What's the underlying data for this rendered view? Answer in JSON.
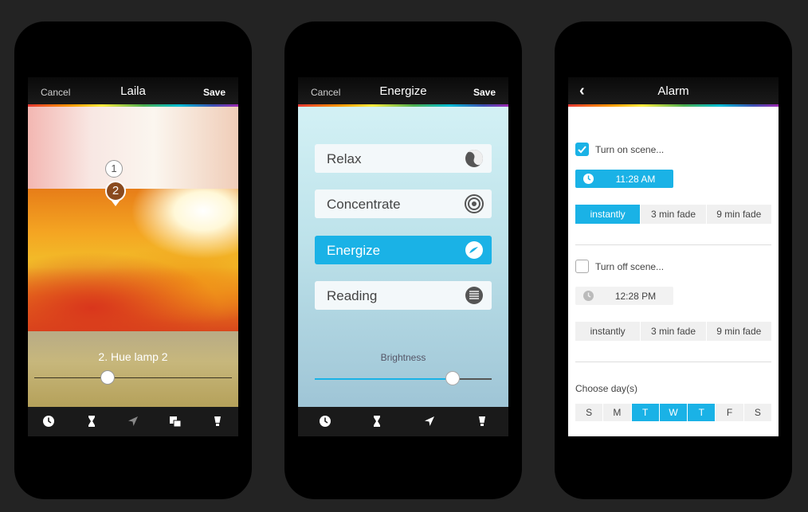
{
  "screen1": {
    "nav": {
      "cancel": "Cancel",
      "title": "Laila",
      "save": "Save"
    },
    "pins": [
      "1",
      "2"
    ],
    "lamp_label": "2. Hue lamp 2",
    "slider_level": 0.37,
    "tabs": [
      "clock-icon",
      "hourglass-icon",
      "location-arrow-icon",
      "scenes-icon",
      "bulb-icon"
    ]
  },
  "screen2": {
    "nav": {
      "cancel": "Cancel",
      "title": "Energize",
      "save": "Save"
    },
    "scenes": [
      {
        "label": "Relax",
        "icon": "relax-icon",
        "active": false
      },
      {
        "label": "Concentrate",
        "icon": "concentrate-icon",
        "active": false
      },
      {
        "label": "Energize",
        "icon": "energize-icon",
        "active": true
      },
      {
        "label": "Reading",
        "icon": "reading-icon",
        "active": false
      }
    ],
    "brightness_label": "Brightness",
    "brightness_level": 0.78,
    "tabs": [
      "clock-icon",
      "hourglass-icon",
      "location-arrow-icon",
      "bulb-icon"
    ]
  },
  "screen3": {
    "nav": {
      "back": "‹",
      "title": "Alarm"
    },
    "turn_on": {
      "label": "Turn on scene...",
      "checked": true,
      "time": "11:28 AM",
      "options": [
        "instantly",
        "3 min fade",
        "9 min fade"
      ],
      "selected": 0
    },
    "turn_off": {
      "label": "Turn off scene...",
      "checked": false,
      "time": "12:28 PM",
      "options": [
        "instantly",
        "3 min fade",
        "9 min fade"
      ],
      "selected": -1
    },
    "choose_days_label": "Choose day(s)",
    "days": [
      {
        "label": "S",
        "selected": false
      },
      {
        "label": "M",
        "selected": false
      },
      {
        "label": "T",
        "selected": true
      },
      {
        "label": "W",
        "selected": true
      },
      {
        "label": "T",
        "selected": true
      },
      {
        "label": "F",
        "selected": false
      },
      {
        "label": "S",
        "selected": false
      }
    ]
  },
  "colors": {
    "accent": "#1ab2e6",
    "phone": "#000000",
    "background": "#232323"
  }
}
